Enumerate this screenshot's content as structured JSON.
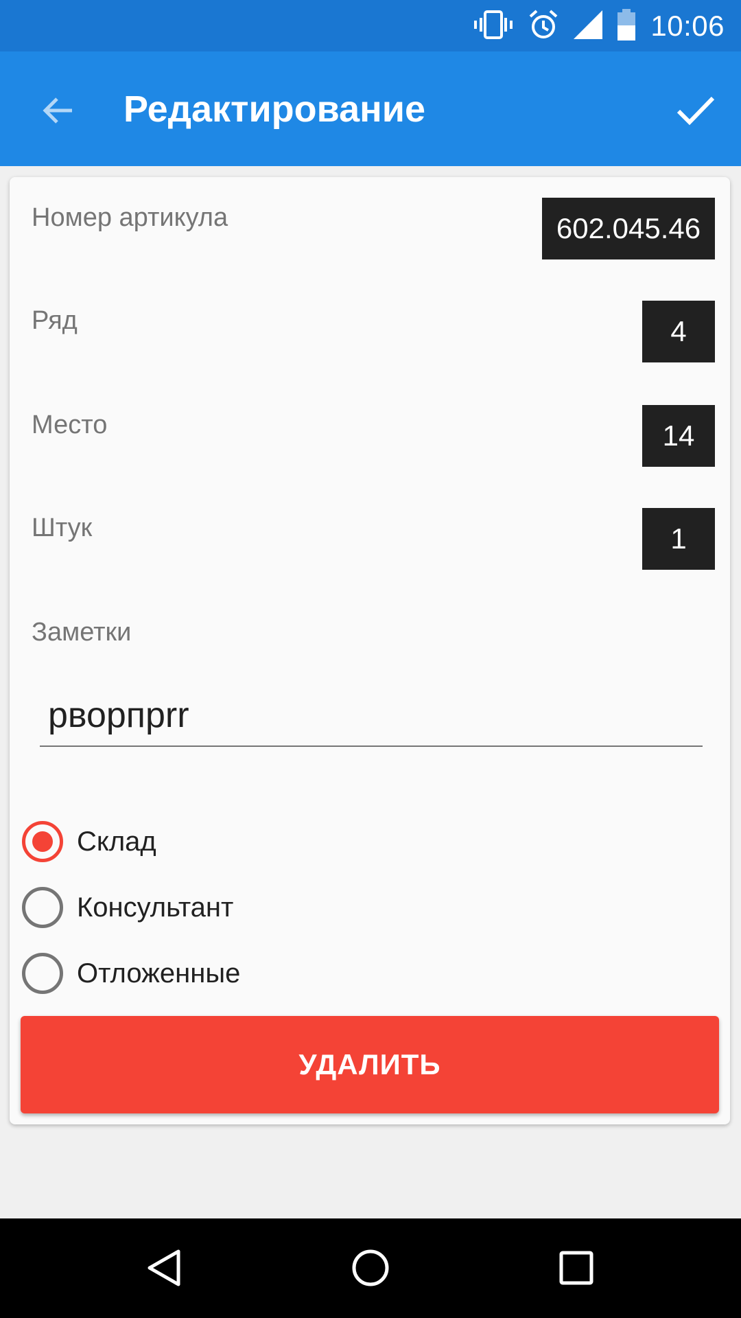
{
  "status_bar": {
    "time": "10:06",
    "icons": [
      "vibrate-icon",
      "alarm-icon",
      "signal-icon",
      "battery-icon"
    ]
  },
  "app_bar": {
    "title": "Редактирование",
    "back_icon": "arrow-back-icon",
    "confirm_icon": "check-icon"
  },
  "form": {
    "article": {
      "label": "Номер артикула",
      "value": "602.045.46"
    },
    "row": {
      "label": "Ряд",
      "value": "4"
    },
    "place": {
      "label": "Место",
      "value": "14"
    },
    "count": {
      "label": "Штук",
      "value": "1"
    },
    "notes": {
      "label": "Заметки",
      "value": "рворпprr"
    },
    "options": [
      {
        "label": "Склад",
        "checked": true
      },
      {
        "label": "Консультант",
        "checked": false
      },
      {
        "label": "Отложенные",
        "checked": false
      }
    ],
    "delete_label": "УДАЛИТЬ"
  },
  "colors": {
    "status_bar": "#1a77d2",
    "app_bar": "#1f88e5",
    "accent": "#f44336",
    "value_box": "#212121"
  },
  "nav_bar": {
    "icons": [
      "back-triangle-icon",
      "home-circle-icon",
      "recents-square-icon"
    ]
  }
}
